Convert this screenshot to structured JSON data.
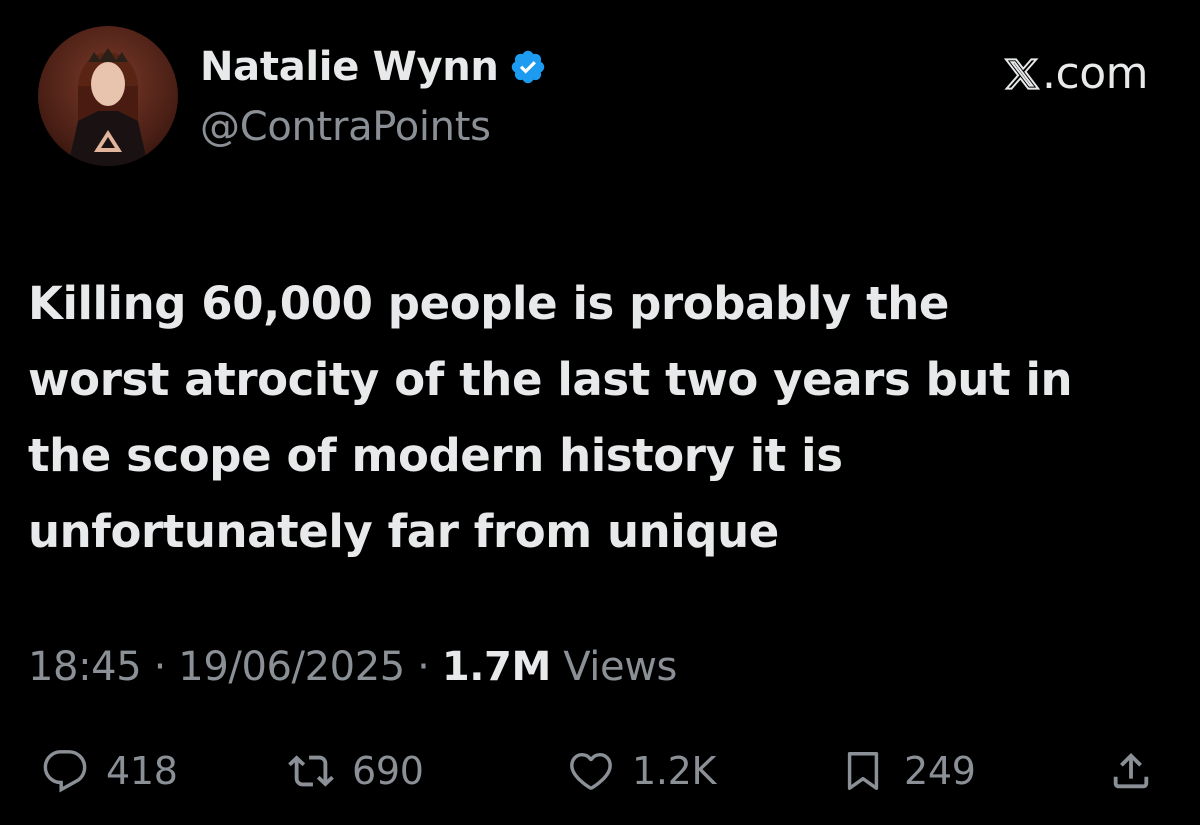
{
  "author": {
    "display_name": "Natalie Wynn",
    "handle": "@ContraPoints",
    "verified": true
  },
  "source": {
    "logo": "x-logo-icon",
    "label": ".com"
  },
  "tweet": {
    "lines": [
      "Killing 60,000 people is probably the",
      "worst atrocity of the last two years but in",
      "the scope of modern history it is",
      "unfortunately far from unique"
    ]
  },
  "meta": {
    "time": "18:45",
    "date": "19/06/2025",
    "separator": "·",
    "views_count": "1.7M",
    "views_label": "Views"
  },
  "actions": {
    "replies": "418",
    "reposts": "690",
    "likes": "1.2K",
    "bookmarks": "249"
  },
  "colors": {
    "background": "#000000",
    "primary_text": "#e7e9ea",
    "secondary_text": "#8b9096",
    "verified_blue": "#1d9bf0"
  }
}
